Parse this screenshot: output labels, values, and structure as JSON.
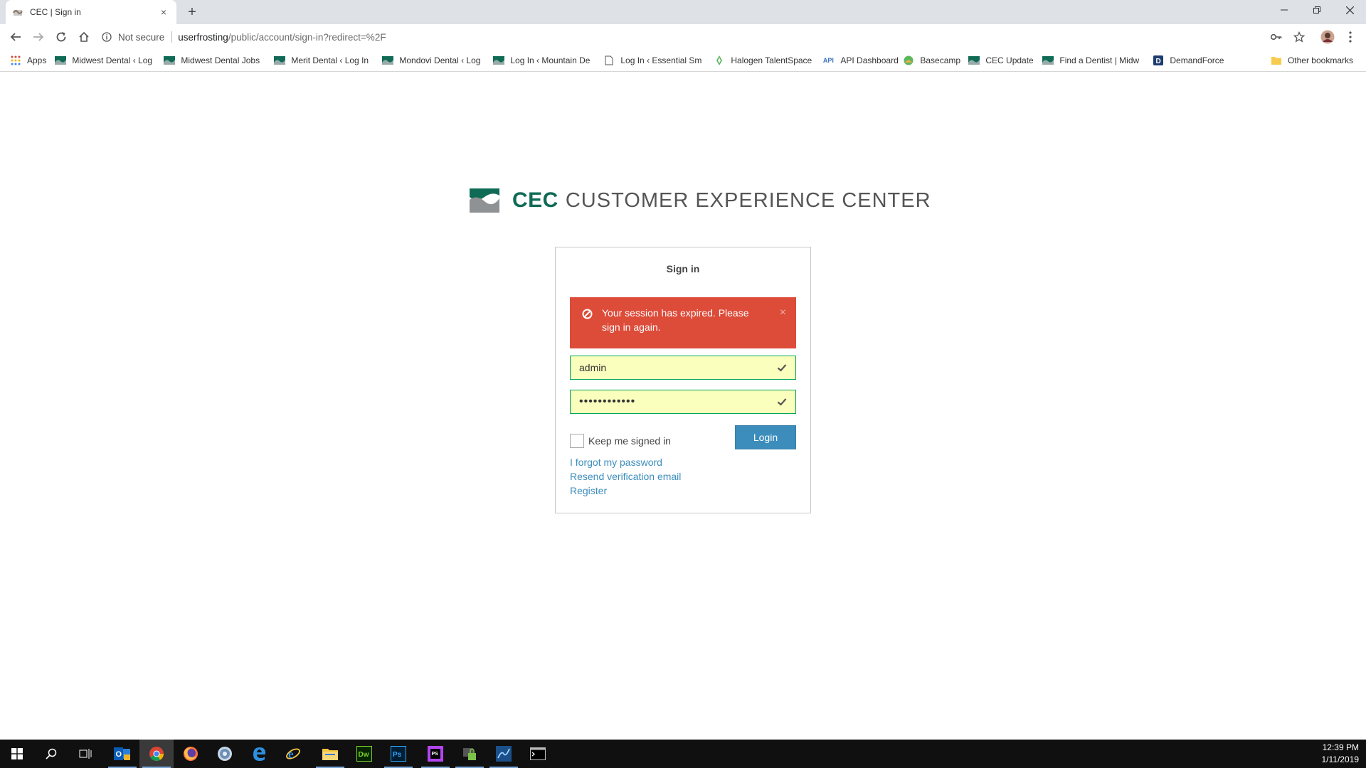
{
  "browser": {
    "tab_title": "CEC | Sign in",
    "tab_close": "×",
    "new_tab": "+",
    "window_controls": {
      "minimize": "—",
      "restore": "❐",
      "close": "✕"
    },
    "security_label": "Not secure",
    "url_host": "userfrosting",
    "url_path": "/public/account/sign-in?redirect=%2F",
    "bookmarks": [
      {
        "label": "Apps",
        "icon": "apps-grid-icon"
      },
      {
        "label": "Midwest Dental ‹ Log",
        "icon": "dental-logo-icon"
      },
      {
        "label": "Midwest Dental Jobs",
        "icon": "dental-logo-icon"
      },
      {
        "label": "Merit Dental ‹ Log In",
        "icon": "dental-logo-icon"
      },
      {
        "label": "Mondovi Dental ‹ Log",
        "icon": "dental-logo-icon"
      },
      {
        "label": "Log In ‹ Mountain De",
        "icon": "dental-logo-icon"
      },
      {
        "label": "Log In ‹ Essential Sm",
        "icon": "page-icon"
      },
      {
        "label": "Halogen TalentSpace",
        "icon": "halogen-icon"
      },
      {
        "label": "API Dashboard",
        "icon": "api-icon"
      },
      {
        "label": "Basecamp",
        "icon": "basecamp-icon"
      },
      {
        "label": "CEC Update",
        "icon": "dental-logo-icon"
      },
      {
        "label": "Find a Dentist | Midw",
        "icon": "dental-logo-icon"
      },
      {
        "label": "DemandForce",
        "icon": "demandforce-icon"
      }
    ],
    "other_bookmarks": "Other bookmarks"
  },
  "page": {
    "brand_abbr": "CEC",
    "brand_full": "CUSTOMER EXPERIENCE CENTER",
    "signin_heading": "Sign in",
    "alert_message": "Your session has expired. Please sign in again.",
    "alert_close": "×",
    "username_value": "admin",
    "password_value": "••••••••••••",
    "keep_signed_in_label": "Keep me signed in",
    "login_button": "Login",
    "links": {
      "forgot": "I forgot my password",
      "resend": "Resend verification email",
      "register": "Register"
    }
  },
  "taskbar": {
    "time": "12:39 PM",
    "date": "1/11/2019"
  },
  "colors": {
    "brand_green": "#0f6b55",
    "alert_red": "#dd4b39",
    "field_border": "#00a65a",
    "autofill_bg": "#faffbd",
    "primary_blue": "#3c8dbc"
  }
}
